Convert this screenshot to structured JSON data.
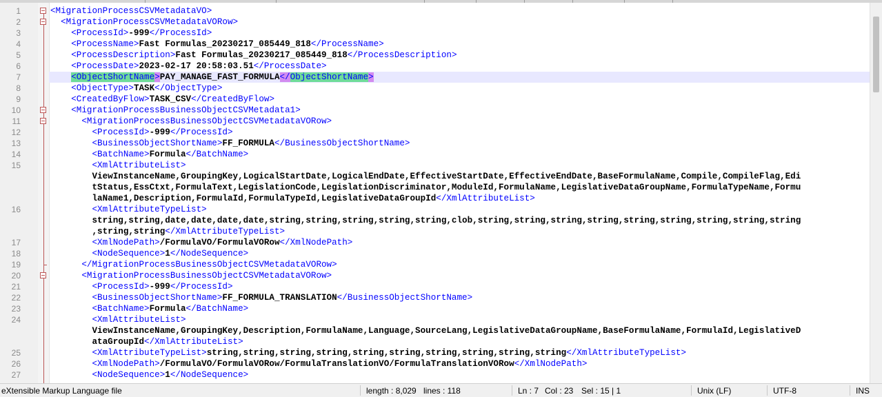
{
  "editor": {
    "current_line": 7,
    "lines": [
      {
        "n": "1",
        "fold": "box",
        "vis": [
          [
            [
              "t",
              "<MigrationProcessCSVMetadataVO>"
            ]
          ]
        ]
      },
      {
        "n": "2",
        "fold": "box",
        "vis": [
          [
            [
              "s",
              "  "
            ],
            [
              "t",
              "<MigrationProcessCSVMetadataVORow>"
            ]
          ]
        ]
      },
      {
        "n": "3",
        "vis": [
          [
            [
              "s",
              "    "
            ],
            [
              "t",
              "<ProcessId>"
            ],
            [
              "v",
              "-999"
            ],
            [
              "t",
              "</ProcessId>"
            ]
          ]
        ]
      },
      {
        "n": "4",
        "vis": [
          [
            [
              "s",
              "    "
            ],
            [
              "t",
              "<ProcessName>"
            ],
            [
              "v",
              "Fast Formulas_20230217_085449_818"
            ],
            [
              "t",
              "</ProcessName>"
            ]
          ]
        ]
      },
      {
        "n": "5",
        "vis": [
          [
            [
              "s",
              "    "
            ],
            [
              "t",
              "<ProcessDescription>"
            ],
            [
              "v",
              "Fast Formulas_20230217_085449_818"
            ],
            [
              "t",
              "</ProcessDescription>"
            ]
          ]
        ]
      },
      {
        "n": "6",
        "vis": [
          [
            [
              "s",
              "    "
            ],
            [
              "t",
              "<ProcessDate>"
            ],
            [
              "v",
              "2023-02-17 20:58:03.51"
            ],
            [
              "t",
              "</ProcessDate>"
            ]
          ]
        ]
      },
      {
        "n": "7",
        "vis": [
          [
            [
              "s",
              "    "
            ],
            [
              "h",
              "<ObjectShortName"
            ],
            [
              "h2",
              ">"
            ],
            [
              "v",
              "PAY_MANAGE_FAST_FORMULA"
            ],
            [
              "h2",
              "</"
            ],
            [
              "h",
              "ObjectShortName"
            ],
            [
              "h2",
              ">"
            ]
          ]
        ]
      },
      {
        "n": "8",
        "vis": [
          [
            [
              "s",
              "    "
            ],
            [
              "t",
              "<ObjectType>"
            ],
            [
              "v",
              "TASK"
            ],
            [
              "t",
              "</ObjectType>"
            ]
          ]
        ]
      },
      {
        "n": "9",
        "vis": [
          [
            [
              "s",
              "    "
            ],
            [
              "t",
              "<CreatedByFlow>"
            ],
            [
              "v",
              "TASK_CSV"
            ],
            [
              "t",
              "</CreatedByFlow>"
            ]
          ]
        ]
      },
      {
        "n": "10",
        "fold": "box",
        "vis": [
          [
            [
              "s",
              "    "
            ],
            [
              "t",
              "<MigrationProcessBusinessObjectCSVMetadata1>"
            ]
          ]
        ]
      },
      {
        "n": "11",
        "fold": "box",
        "vis": [
          [
            [
              "s",
              "      "
            ],
            [
              "t",
              "<MigrationProcessBusinessObjectCSVMetadataVORow>"
            ]
          ]
        ]
      },
      {
        "n": "12",
        "vis": [
          [
            [
              "s",
              "        "
            ],
            [
              "t",
              "<ProcessId>"
            ],
            [
              "v",
              "-999"
            ],
            [
              "t",
              "</ProcessId>"
            ]
          ]
        ]
      },
      {
        "n": "13",
        "vis": [
          [
            [
              "s",
              "        "
            ],
            [
              "t",
              "<BusinessObjectShortName>"
            ],
            [
              "v",
              "FF_FORMULA"
            ],
            [
              "t",
              "</BusinessObjectShortName>"
            ]
          ]
        ]
      },
      {
        "n": "14",
        "vis": [
          [
            [
              "s",
              "        "
            ],
            [
              "t",
              "<BatchName>"
            ],
            [
              "v",
              "Formula"
            ],
            [
              "t",
              "</BatchName>"
            ]
          ]
        ]
      },
      {
        "n": "15",
        "vis": [
          [
            [
              "s",
              "        "
            ],
            [
              "t",
              "<XmlAttributeList>"
            ]
          ],
          [
            [
              "s",
              "        "
            ],
            [
              "v",
              "ViewInstanceName,GroupingKey,LogicalStartDate,LogicalEndDate,EffectiveStartDate,EffectiveEndDate,BaseFormulaName,Compile,CompileFlag,Edi"
            ]
          ],
          [
            [
              "s",
              "        "
            ],
            [
              "v",
              "tStatus,EssCtxt,FormulaText,LegislationCode,LegislationDiscriminator,ModuleId,FormulaName,LegislativeDataGroupName,FormulaTypeName,Formu"
            ]
          ],
          [
            [
              "s",
              "        "
            ],
            [
              "v",
              "laName1,Description,FormulaId,FormulaTypeId,LegislativeDataGroupId"
            ],
            [
              "t",
              "</XmlAttributeList>"
            ]
          ]
        ]
      },
      {
        "n": "16",
        "vis": [
          [
            [
              "s",
              "        "
            ],
            [
              "t",
              "<XmlAttributeTypeList>"
            ]
          ],
          [
            [
              "s",
              "        "
            ],
            [
              "v",
              "string,string,date,date,date,date,string,string,string,string,string,clob,string,string,string,string,string,string,string,string,string"
            ]
          ],
          [
            [
              "s",
              "        "
            ],
            [
              "v",
              ",string,string"
            ],
            [
              "t",
              "</XmlAttributeTypeList>"
            ]
          ]
        ]
      },
      {
        "n": "17",
        "vis": [
          [
            [
              "s",
              "        "
            ],
            [
              "t",
              "<XmlNodePath>"
            ],
            [
              "v",
              "/FormulaVO/FormulaVORow"
            ],
            [
              "t",
              "</XmlNodePath>"
            ]
          ]
        ]
      },
      {
        "n": "18",
        "vis": [
          [
            [
              "s",
              "        "
            ],
            [
              "t",
              "<NodeSequence>"
            ],
            [
              "v",
              "1"
            ],
            [
              "t",
              "</NodeSequence>"
            ]
          ]
        ]
      },
      {
        "n": "19",
        "fold": "end",
        "vis": [
          [
            [
              "s",
              "      "
            ],
            [
              "t",
              "</MigrationProcessBusinessObjectCSVMetadataVORow>"
            ]
          ]
        ]
      },
      {
        "n": "20",
        "fold": "box",
        "vis": [
          [
            [
              "s",
              "      "
            ],
            [
              "t",
              "<MigrationProcessBusinessObjectCSVMetadataVORow>"
            ]
          ]
        ]
      },
      {
        "n": "21",
        "vis": [
          [
            [
              "s",
              "        "
            ],
            [
              "t",
              "<ProcessId>"
            ],
            [
              "v",
              "-999"
            ],
            [
              "t",
              "</ProcessId>"
            ]
          ]
        ]
      },
      {
        "n": "22",
        "vis": [
          [
            [
              "s",
              "        "
            ],
            [
              "t",
              "<BusinessObjectShortName>"
            ],
            [
              "v",
              "FF_FORMULA_TRANSLATION"
            ],
            [
              "t",
              "</BusinessObjectShortName>"
            ]
          ]
        ]
      },
      {
        "n": "23",
        "vis": [
          [
            [
              "s",
              "        "
            ],
            [
              "t",
              "<BatchName>"
            ],
            [
              "v",
              "Formula"
            ],
            [
              "t",
              "</BatchName>"
            ]
          ]
        ]
      },
      {
        "n": "24",
        "vis": [
          [
            [
              "s",
              "        "
            ],
            [
              "t",
              "<XmlAttributeList>"
            ]
          ],
          [
            [
              "s",
              "        "
            ],
            [
              "v",
              "ViewInstanceName,GroupingKey,Description,FormulaName,Language,SourceLang,LegislativeDataGroupName,BaseFormulaName,FormulaId,LegislativeD"
            ]
          ],
          [
            [
              "s",
              "        "
            ],
            [
              "v",
              "ataGroupId"
            ],
            [
              "t",
              "</XmlAttributeList>"
            ]
          ]
        ]
      },
      {
        "n": "25",
        "vis": [
          [
            [
              "s",
              "        "
            ],
            [
              "t",
              "<XmlAttributeTypeList>"
            ],
            [
              "v",
              "string,string,string,string,string,string,string,string,string,string"
            ],
            [
              "t",
              "</XmlAttributeTypeList>"
            ]
          ]
        ]
      },
      {
        "n": "26",
        "vis": [
          [
            [
              "s",
              "        "
            ],
            [
              "t",
              "<XmlNodePath>"
            ],
            [
              "v",
              "/FormulaVO/FormulaVORow/FormulaTranslationVO/FormulaTranslationVORow"
            ],
            [
              "t",
              "</XmlNodePath>"
            ]
          ]
        ]
      },
      {
        "n": "27",
        "vis": [
          [
            [
              "s",
              "        "
            ],
            [
              "t",
              "<NodeSequence>"
            ],
            [
              "v",
              "1"
            ],
            [
              "t",
              "</NodeSequence>"
            ]
          ]
        ]
      }
    ]
  },
  "status": {
    "language": "eXtensible Markup Language file",
    "length": "length : 8,029",
    "lines": "lines : 118",
    "ln": "Ln : 7",
    "col": "Col : 23",
    "sel": "Sel : 15 | 1",
    "eol": "Unix (LF)",
    "encoding": "UTF-8",
    "mode": "INS"
  }
}
